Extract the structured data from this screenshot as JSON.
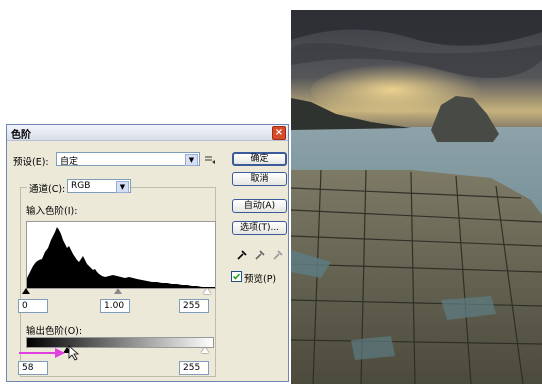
{
  "dialog": {
    "title": "色阶",
    "preset_label": "预设(E):",
    "preset_value": "自定",
    "channel_label": "通道(C):",
    "channel_value": "RGB",
    "input_levels_label": "输入色阶(I):",
    "input_black": "0",
    "input_mid": "1.00",
    "input_white": "255",
    "output_levels_label": "输出色阶(O):",
    "output_black": "58",
    "output_white": "255",
    "buttons": {
      "ok": "确定",
      "cancel": "取消",
      "auto": "自动(A)",
      "options": "选项(T)..."
    },
    "preview_label": "预览(P)",
    "preview_checked": true
  }
}
